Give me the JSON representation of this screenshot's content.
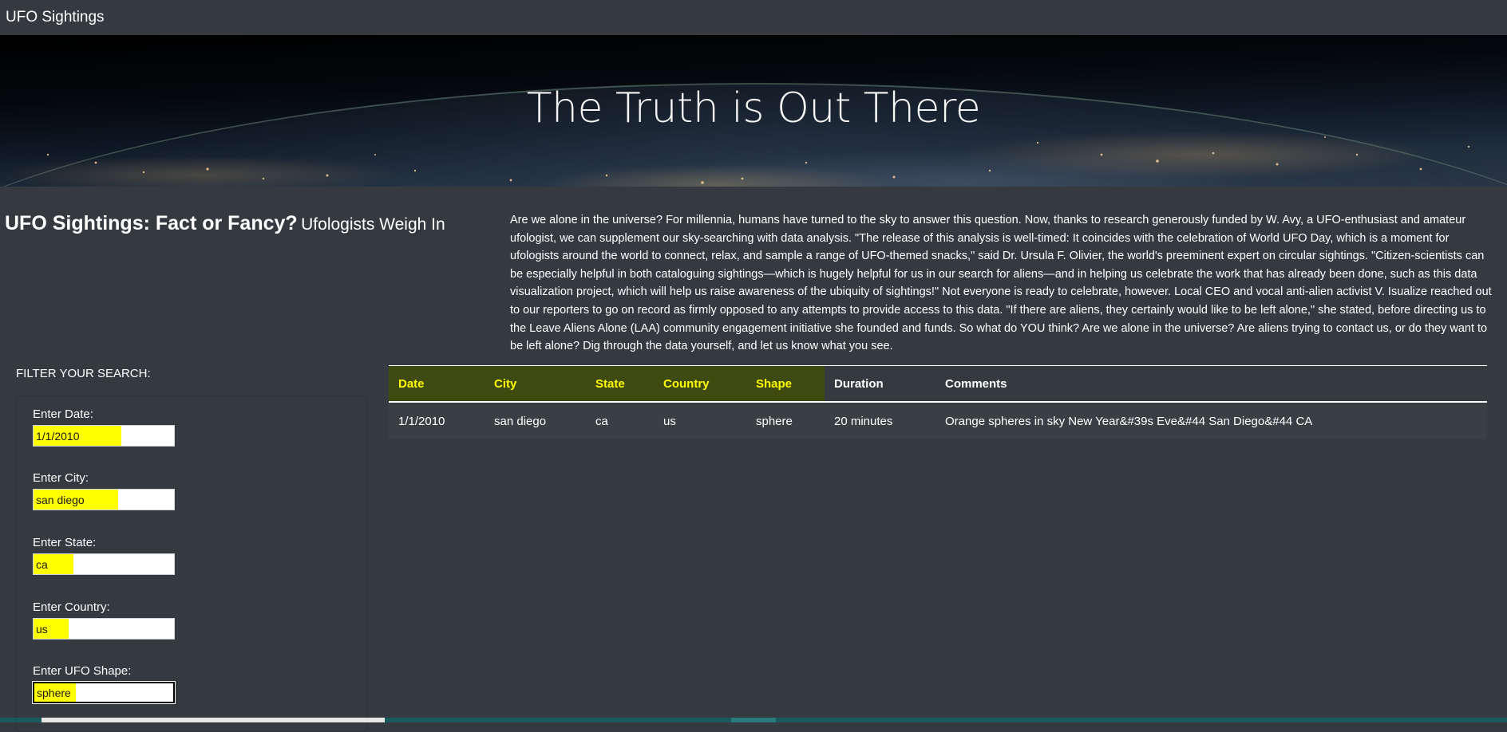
{
  "navbar": {
    "brand": "UFO Sightings"
  },
  "hero": {
    "title": "The Truth is Out There"
  },
  "intro": {
    "heading": "UFO Sightings: Fact or Fancy?",
    "subheading": "Ufologists Weigh In",
    "article": "Are we alone in the universe? For millennia, humans have turned to the sky to answer this question. Now, thanks to research generously funded by W. Avy, a UFO-enthusiast and amateur ufologist, we can supplement our sky-searching with data analysis. \"The release of this analysis is well-timed: It coincides with the celebration of World UFO Day, which is a moment for ufologists around the world to connect, relax, and sample a range of UFO-themed snacks,\" said Dr. Ursula F. Olivier, the world's preeminent expert on circular sightings. \"Citizen-scientists can be especially helpful in both cataloguing sightings—which is hugely helpful for us in our search for aliens—and in helping us celebrate the work that has already been done, such as this data visualization project, which will help us raise awareness of the ubiquity of sightings!\" Not everyone is ready to celebrate, however. Local CEO and vocal anti-alien activist V. Isualize reached out to our reporters to go on record as firmly opposed to any attempts to provide access to this data. \"If there are aliens, they certainly would like to be left alone,\" she stated, before directing us to the Leave Aliens Alone (LAA) community engagement initiative she founded and funds. So what do YOU think? Are we alone in the universe? Are aliens trying to contact us, or do they want to be left alone? Dig through the data yourself, and let us know what you see."
  },
  "filters": {
    "title": "FILTER YOUR SEARCH:",
    "items": [
      {
        "label": "Enter Date:",
        "value": "1/1/2010"
      },
      {
        "label": "Enter City:",
        "value": "san diego"
      },
      {
        "label": "Enter State:",
        "value": "ca"
      },
      {
        "label": "Enter Country:",
        "value": "us"
      },
      {
        "label": "Enter UFO Shape:",
        "value": "sphere"
      }
    ]
  },
  "table": {
    "headers": [
      "Date",
      "City",
      "State",
      "Country",
      "Shape",
      "Duration",
      "Comments"
    ],
    "rows": [
      [
        "1/1/2010",
        "san diego",
        "ca",
        "us",
        "sphere",
        "20 minutes",
        "Orange spheres in sky New Year&#39s Eve&#44 San Diego&#44 CA"
      ]
    ]
  },
  "colors": {
    "background": "#343a40",
    "highlight": "#ffff00",
    "text": "#ffffff"
  }
}
